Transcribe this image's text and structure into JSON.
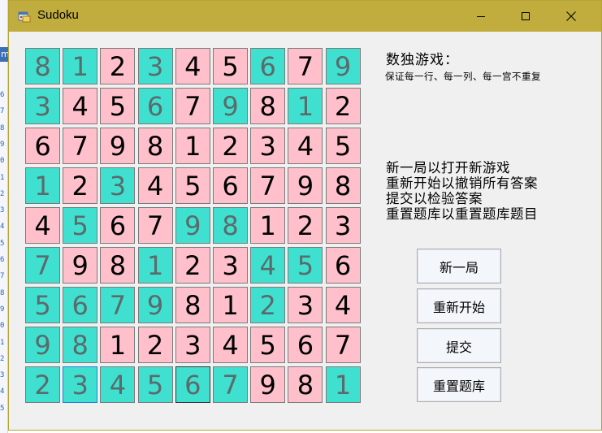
{
  "window": {
    "title": "Sudoku",
    "colors": {
      "titlebar": "#c1ad3d",
      "given_cell": "#40e0d0",
      "answer_cell": "#ffc0cb"
    }
  },
  "desktop": {
    "line_numbers": [
      "6",
      "7",
      "8",
      "9",
      "0",
      "1",
      "2",
      "3",
      "4",
      "5",
      "6",
      "7",
      "8",
      "9",
      "0",
      "1",
      "2",
      "3",
      "4",
      "5"
    ],
    "partial_text": "m"
  },
  "board": {
    "rows": [
      [
        {
          "v": "8",
          "g": true
        },
        {
          "v": "1",
          "g": true
        },
        {
          "v": "2",
          "g": false
        },
        {
          "v": "3",
          "g": true
        },
        {
          "v": "4",
          "g": false
        },
        {
          "v": "5",
          "g": false
        },
        {
          "v": "6",
          "g": true
        },
        {
          "v": "7",
          "g": false
        },
        {
          "v": "9",
          "g": true
        }
      ],
      [
        {
          "v": "3",
          "g": true
        },
        {
          "v": "4",
          "g": false
        },
        {
          "v": "5",
          "g": false
        },
        {
          "v": "6",
          "g": true
        },
        {
          "v": "7",
          "g": false
        },
        {
          "v": "9",
          "g": true
        },
        {
          "v": "8",
          "g": false
        },
        {
          "v": "1",
          "g": true
        },
        {
          "v": "2",
          "g": false
        }
      ],
      [
        {
          "v": "6",
          "g": false
        },
        {
          "v": "7",
          "g": false
        },
        {
          "v": "9",
          "g": false
        },
        {
          "v": "8",
          "g": false
        },
        {
          "v": "1",
          "g": false
        },
        {
          "v": "2",
          "g": false
        },
        {
          "v": "3",
          "g": false
        },
        {
          "v": "4",
          "g": false
        },
        {
          "v": "5",
          "g": false
        }
      ],
      [
        {
          "v": "1",
          "g": true
        },
        {
          "v": "2",
          "g": false
        },
        {
          "v": "3",
          "g": true
        },
        {
          "v": "4",
          "g": false
        },
        {
          "v": "5",
          "g": false
        },
        {
          "v": "6",
          "g": false
        },
        {
          "v": "7",
          "g": false
        },
        {
          "v": "9",
          "g": false
        },
        {
          "v": "8",
          "g": false
        }
      ],
      [
        {
          "v": "4",
          "g": false
        },
        {
          "v": "5",
          "g": true
        },
        {
          "v": "6",
          "g": false
        },
        {
          "v": "7",
          "g": false
        },
        {
          "v": "9",
          "g": true
        },
        {
          "v": "8",
          "g": true
        },
        {
          "v": "1",
          "g": false
        },
        {
          "v": "2",
          "g": false
        },
        {
          "v": "3",
          "g": false
        }
      ],
      [
        {
          "v": "7",
          "g": true
        },
        {
          "v": "9",
          "g": false
        },
        {
          "v": "8",
          "g": false
        },
        {
          "v": "1",
          "g": true
        },
        {
          "v": "2",
          "g": false
        },
        {
          "v": "3",
          "g": false
        },
        {
          "v": "4",
          "g": true
        },
        {
          "v": "5",
          "g": true
        },
        {
          "v": "6",
          "g": false
        }
      ],
      [
        {
          "v": "5",
          "g": true
        },
        {
          "v": "6",
          "g": true
        },
        {
          "v": "7",
          "g": true
        },
        {
          "v": "9",
          "g": true
        },
        {
          "v": "8",
          "g": false
        },
        {
          "v": "1",
          "g": false
        },
        {
          "v": "2",
          "g": true
        },
        {
          "v": "3",
          "g": false
        },
        {
          "v": "4",
          "g": false
        }
      ],
      [
        {
          "v": "9",
          "g": true
        },
        {
          "v": "8",
          "g": true
        },
        {
          "v": "1",
          "g": false
        },
        {
          "v": "2",
          "g": false
        },
        {
          "v": "3",
          "g": false
        },
        {
          "v": "4",
          "g": false
        },
        {
          "v": "5",
          "g": false
        },
        {
          "v": "6",
          "g": false
        },
        {
          "v": "7",
          "g": false
        }
      ],
      [
        {
          "v": "2",
          "g": true
        },
        {
          "v": "3",
          "g": true,
          "sel": "blue"
        },
        {
          "v": "4",
          "g": true
        },
        {
          "v": "5",
          "g": true
        },
        {
          "v": "6",
          "g": true,
          "sel": "dark"
        },
        {
          "v": "7",
          "g": true
        },
        {
          "v": "9",
          "g": false
        },
        {
          "v": "8",
          "g": false
        },
        {
          "v": "1",
          "g": true
        }
      ]
    ]
  },
  "info": {
    "title": "数独游戏：",
    "rule": "保证每一行、每一列、每一宫不重复",
    "help_lines": [
      "新一局以打开新游戏",
      "重新开始以撤销所有答案",
      "提交以检验答案",
      "重置题库以重置题库题目"
    ]
  },
  "buttons": {
    "new_game": "新一局",
    "restart": "重新开始",
    "submit": "提交",
    "reset_bank": "重置题库"
  }
}
